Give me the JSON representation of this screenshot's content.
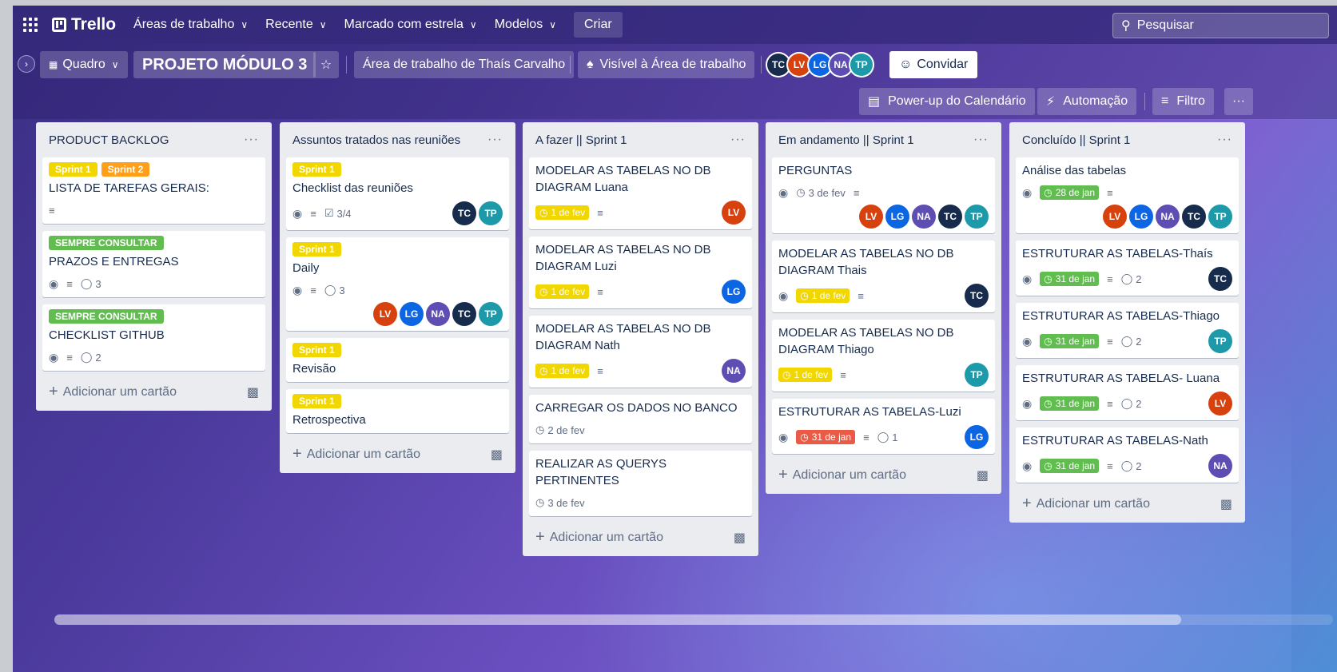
{
  "nav": {
    "logo": "Trello",
    "items": [
      "Áreas de trabalho",
      "Recente",
      "Marcado com estrela",
      "Modelos"
    ],
    "create": "Criar",
    "search_placeholder": "Pesquisar"
  },
  "board": {
    "view": "Quadro",
    "title": "PROJETO MÓDULO 3",
    "workspace": "Área de trabalho de Thaís Carvalho",
    "visibility": "Visível à Área de trabalho",
    "invite": "Convidar",
    "calendar": "Power-up do Calendário",
    "automation": "Automação",
    "filter": "Filtro",
    "more": "···"
  },
  "members": {
    "TC": {
      "initials": "TC",
      "color": "#172b4d"
    },
    "LV": {
      "initials": "LV",
      "color": "#d6410e"
    },
    "LG": {
      "initials": "LG",
      "color": "#0c66e4"
    },
    "NA": {
      "initials": "NA",
      "color": "#5e4db2"
    },
    "TP": {
      "initials": "TP",
      "color": "#1d9aaa"
    }
  },
  "add_card": "Adicionar um cartão",
  "lists": [
    {
      "title": "PRODUCT BACKLOG",
      "cards": [
        {
          "labels": [
            "Sprint 1",
            "Sprint 2"
          ],
          "title": "LISTA DE TAREFAS GERAIS:"
        },
        {
          "labels": [
            "SEMPRE CONSULTAR"
          ],
          "title": "PRAZOS E ENTREGAS",
          "comments": "3"
        },
        {
          "labels": [
            "SEMPRE CONSULTAR"
          ],
          "title": "CHECKLIST GITHUB",
          "comments": "2"
        }
      ]
    },
    {
      "title": "Assuntos tratados nas reuniões",
      "cards": [
        {
          "labels": [
            "Sprint 1"
          ],
          "title": "Checklist das reuniões",
          "checklist": "3/4"
        },
        {
          "labels": [
            "Sprint 1"
          ],
          "title": "Daily",
          "comments": "3"
        },
        {
          "labels": [
            "Sprint 1"
          ],
          "title": "Revisão"
        },
        {
          "labels": [
            "Sprint 1"
          ],
          "title": "Retrospectiva"
        }
      ]
    },
    {
      "title": "A fazer || Sprint 1",
      "cards": [
        {
          "title": "MODELAR AS TABELAS NO DB DIAGRAM Luana",
          "due": "1 de fev"
        },
        {
          "title": "MODELAR AS TABELAS NO DB DIAGRAM Luzi",
          "due": "1 de fev"
        },
        {
          "title": "MODELAR AS TABELAS NO DB DIAGRAM Nath",
          "due": "1 de fev"
        },
        {
          "title": "CARREGAR OS DADOS NO BANCO",
          "date": "2 de fev"
        },
        {
          "title": "REALIZAR AS QUERYS PERTINENTES",
          "date": "3 de fev"
        }
      ]
    },
    {
      "title": "Em andamento || Sprint 1",
      "cards": [
        {
          "title": "PERGUNTAS",
          "date": "3 de fev"
        },
        {
          "title": "MODELAR AS TABELAS NO DB DIAGRAM Thais",
          "due": "1 de fev"
        },
        {
          "title": "MODELAR AS TABELAS NO DB DIAGRAM Thiago",
          "due": "1 de fev"
        },
        {
          "title": "ESTRUTURAR AS TABELAS-Luzi",
          "due": "31 de jan",
          "comments": "1"
        }
      ]
    },
    {
      "title": "Concluído || Sprint 1",
      "cards": [
        {
          "title": "Análise das tabelas",
          "due": "28 de jan"
        },
        {
          "title": "ESTRUTURAR AS TABELAS-Thaís",
          "due": "31 de jan",
          "comments": "2"
        },
        {
          "title": "ESTRUTURAR AS TABELAS-Thiago",
          "due": "31 de jan",
          "comments": "2"
        },
        {
          "title": "ESTRUTURAR AS TABELAS- Luana",
          "due": "31 de jan",
          "comments": "2"
        },
        {
          "title": "ESTRUTURAR AS TABELAS-Nath",
          "due": "31 de jan",
          "comments": "2"
        }
      ]
    }
  ]
}
